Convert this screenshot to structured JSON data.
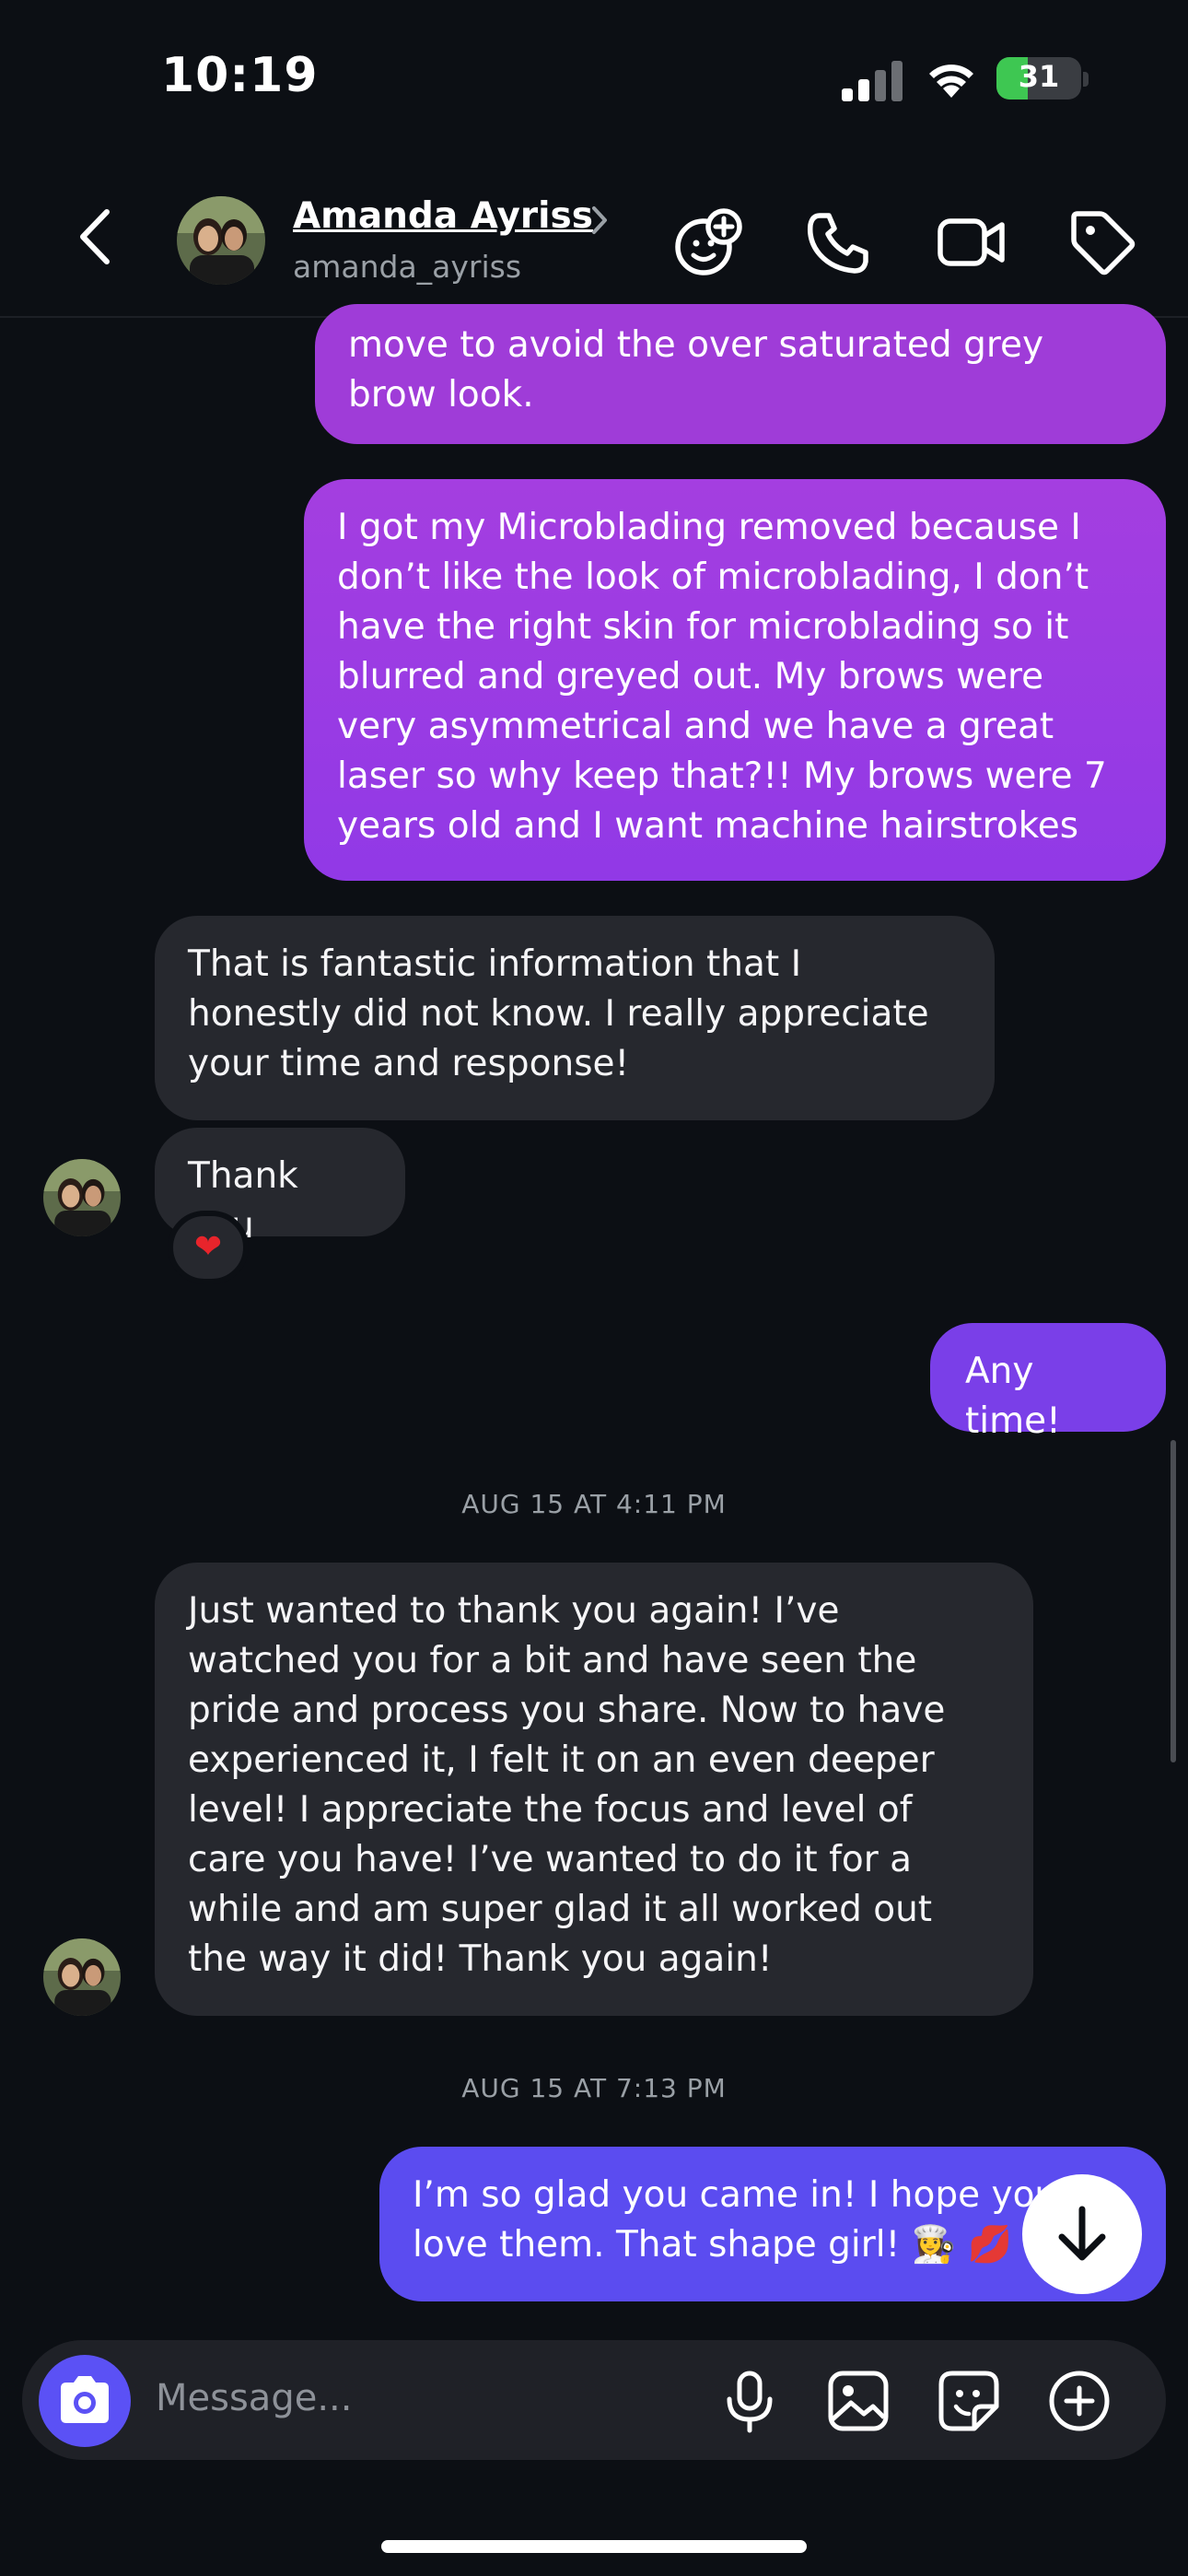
{
  "status_bar": {
    "time": "10:19",
    "battery": "31"
  },
  "header": {
    "name": "Amanda Ayriss",
    "handle": "amanda_ayriss"
  },
  "messages": {
    "m1": "move to avoid the over saturated grey brow look.",
    "m2": "I got my Microblading removed because I don’t like the look of microblading, I don’t have the right skin for microblading so it blurred and greyed out. My brows were very asymmetrical and we have a great laser so why keep that?!! My brows were 7 years old and I want machine hairstrokes",
    "m3": "That is fantastic information that I honestly did not know. I really appreciate your time and response!",
    "m4": "Thank you",
    "m4_reaction": "❤",
    "m5": "Any time!",
    "ts1": "AUG 15 AT 4:11 PM",
    "m6": "Just wanted to thank you again! I’ve watched you for a bit and have seen the pride and process you share. Now to have experienced it, I felt it on an even deeper level! I appreciate the focus and level of care you have! I’ve wanted to do it for a while and am super glad it all worked out the way it did! Thank you again!",
    "ts2": "AUG 15 AT 7:13 PM",
    "m7": "I’m so glad you came in! I hope you love them. That shape girl! 👩‍🍳 💋"
  },
  "composer": {
    "placeholder": "Message..."
  },
  "icons": {
    "back": "chevron-left-icon",
    "effects": "face-plus-icon",
    "call": "phone-icon",
    "video": "video-icon",
    "tag": "tag-icon",
    "camera": "camera-icon",
    "mic": "microphone-icon",
    "gallery": "image-icon",
    "sticker": "sticker-icon",
    "more": "plus-circle-icon",
    "scroll": "arrow-down-icon"
  },
  "colors": {
    "background": "#0c0f14",
    "received_bubble": "#26282e",
    "sent_top": "#a43ee0",
    "sent_bottom": "#5b4cf0",
    "accent": "#5b51f5"
  }
}
